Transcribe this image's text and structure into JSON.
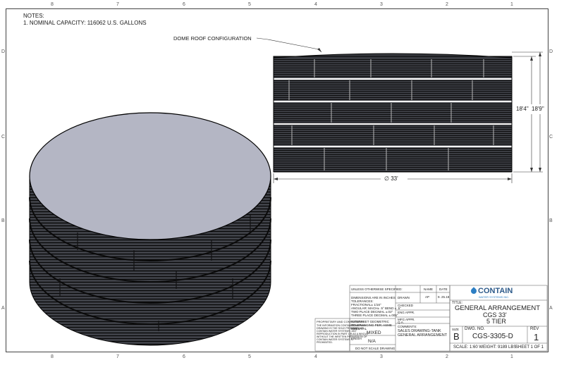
{
  "notes": {
    "heading": "NOTES:",
    "item1": "1. NOMINAL CAPACITY: 116062 U.S. GALLONS"
  },
  "callout": {
    "dome_roof": "DOME ROOF CONFIGURATION"
  },
  "dimensions": {
    "height_shell": "18'4\"",
    "height_total": "18'9\"",
    "diameter": "∅ 33'"
  },
  "zones": {
    "columns": [
      "8",
      "7",
      "6",
      "5",
      "4",
      "3",
      "2",
      "1"
    ],
    "rows": [
      "D",
      "C",
      "B",
      "A"
    ]
  },
  "title_block": {
    "unless_specified": "UNLESS OTHERWISE SPECIFIED:",
    "tolerance_lines": [
      "DIMENSIONS ARE IN INCHES",
      "TOLERANCES:",
      "FRACTIONAL± 1/16\"",
      "ANGULAR: MACH± .5° BEND ± .5°",
      "TWO PLACE DECIMAL   ±.02\"",
      "THREE PLACE DECIMAL  ±.005\""
    ],
    "geometric": "INTERPRET GEOMETRIC TOLERANCING PER: ASME Y14.5",
    "material_label": "MATERIAL",
    "material_value": "MIXED",
    "finish_label": "FINISH",
    "finish_value": "N/A",
    "do_not_scale": "DO NOT SCALE DRAWING",
    "proprietary_heading": "PROPRIETARY AND CONFIDENTIAL",
    "proprietary_lines": [
      "THE INFORMATION CONTAINED IN THIS",
      "DRAWING IS THE SOLE PROPERTY OF",
      "CONTAIN WATER SYSTEMS. ANY",
      "REPRODUCTION IN PART OR AS A WHOLE",
      "WITHOUT THE WRITTEN PERMISSION OF",
      "CONTAIN WATER SYSTEMS IS",
      "PROHIBITED."
    ],
    "name_header": "NAME",
    "date_header": "DATE",
    "drawn_label": "DRAWN",
    "drawn_name": "AP",
    "drawn_date": "9. 25.18",
    "checked_label": "CHECKED",
    "eng_label": "ENG APPR.",
    "mfg_label": "MFG APPR.",
    "qa_label": "Q.A.",
    "comments_label": "COMMENTS:",
    "comments_lines": [
      "SALES DRAWING-TANK",
      "GENERAL ARRANGEMENT"
    ],
    "company_name": "CONTAIN",
    "company_sub": "WATER SYSTEMS INC.",
    "title_label": "TITLE:",
    "title_lines": [
      "GENERAL ARRANGEMENT",
      "CGS 33'",
      "5 TIER"
    ],
    "size_label": "SIZE",
    "size_value": "B",
    "dwg_label": "DWG.  NO.",
    "dwg_value": "CGS-3305-D",
    "rev_label": "REV",
    "rev_value": "1",
    "scale": "SCALE: 1:60 WEIGHT: 9189 LBS",
    "sheet": "SHEET 1 OF 1"
  },
  "colors": {
    "tank_top": "#b4b6c4",
    "tank_band": "#2b2d33",
    "tank_line": "#0a0a0a",
    "logo_blue": "#2d7fc4"
  }
}
